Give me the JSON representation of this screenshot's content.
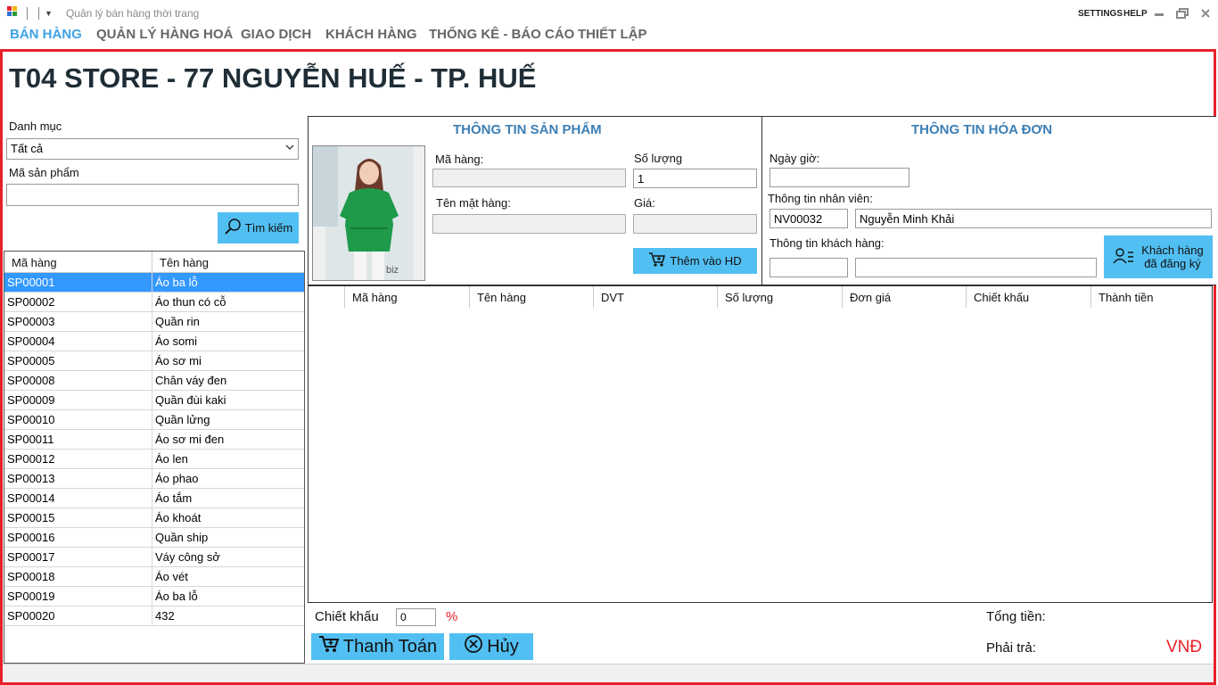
{
  "window": {
    "title": "Quản lý bán hàng thời trang",
    "settings_label": "SETTINGS",
    "help_label": "HELP"
  },
  "menu": [
    {
      "label": "BÁN HÀNG",
      "active": true
    },
    {
      "label": "QUẢN LÝ HÀNG HOÁ",
      "active": false
    },
    {
      "label": "GIAO DỊCH",
      "active": false
    },
    {
      "label": "KHÁCH HÀNG",
      "active": false
    },
    {
      "label": "THỐNG KÊ - BÁO CÁO",
      "active": false
    },
    {
      "label": "THIẾT LẬP",
      "active": false
    }
  ],
  "store_title": "T04 STORE - 77 NGUYỄN HUẾ - TP. HUẾ",
  "filter": {
    "category_label": "Danh mục",
    "category_value": "Tất cả",
    "code_label": "Mã sản phẩm",
    "code_value": "",
    "search_button": "Tìm kiếm"
  },
  "product_list": {
    "columns": [
      "Mã hàng",
      "Tên hàng"
    ],
    "rows": [
      [
        "SP00001",
        "Áo ba lỗ"
      ],
      [
        "SP00002",
        "Áo thun có cỗ"
      ],
      [
        "SP00003",
        "Quần rin"
      ],
      [
        "SP00004",
        "Áo somi"
      ],
      [
        "SP00005",
        "Áo sơ mi"
      ],
      [
        "SP00008",
        "Chân váy đen"
      ],
      [
        "SP00009",
        "Quần đùi kaki"
      ],
      [
        "SP00010",
        "Quần lửng"
      ],
      [
        "SP00011",
        "Áo sơ mi đen"
      ],
      [
        "SP00012",
        "Áo len"
      ],
      [
        "SP00013",
        "Áo phao"
      ],
      [
        "SP00014",
        "Áo tắm"
      ],
      [
        "SP00015",
        "Áo khoát"
      ],
      [
        "SP00016",
        "Quần ship"
      ],
      [
        "SP00017",
        "Váy công sở"
      ],
      [
        "SP00018",
        "Áo vét"
      ],
      [
        "SP00019",
        "Áo ba lỗ"
      ],
      [
        "SP00020",
        "432"
      ]
    ],
    "selected_index": 0
  },
  "product_info": {
    "title": "THÔNG TIN SẢN PHẨM",
    "code_label": "Mã hàng:",
    "code_value": "",
    "qty_label": "Số lượng",
    "qty_value": "1",
    "name_label": "Tên mặt hàng:",
    "name_value": "",
    "price_label": "Giá:",
    "price_value": "",
    "add_button": "Thêm vào HD",
    "image_watermark": "biz"
  },
  "invoice_info": {
    "title": "THÔNG TIN HÓA ĐƠN",
    "datetime_label": "Ngày giờ:",
    "datetime_value": "",
    "staff_label": "Thông tin nhân viên:",
    "staff_id": "NV00032",
    "staff_name": "Nguyễn Minh Khải",
    "customer_label": "Thông tin khách hàng:",
    "customer_id": "",
    "customer_name": "",
    "registered_button_line1": "Khách hàng",
    "registered_button_line2": "đã đăng ký"
  },
  "invoice_grid": {
    "columns": [
      "Mã hàng",
      "Tên hàng",
      "DVT",
      "Số lượng",
      "Đơn giá",
      "Chiết khấu",
      "Thành tiền"
    ]
  },
  "summary": {
    "discount_label": "Chiết khấu",
    "discount_value": "0",
    "percent_sign": "%",
    "pay_button": "Thanh Toán",
    "cancel_button": "Hủy",
    "total_label": "Tổng tiền:",
    "payable_label": "Phải trả:",
    "currency": "VNĐ"
  },
  "colors": {
    "accent": "#52bff2",
    "frame": "#e8202a",
    "selection": "#3399ff",
    "panel_title": "#3c7fb5",
    "active_menu": "#3ea3e6"
  }
}
